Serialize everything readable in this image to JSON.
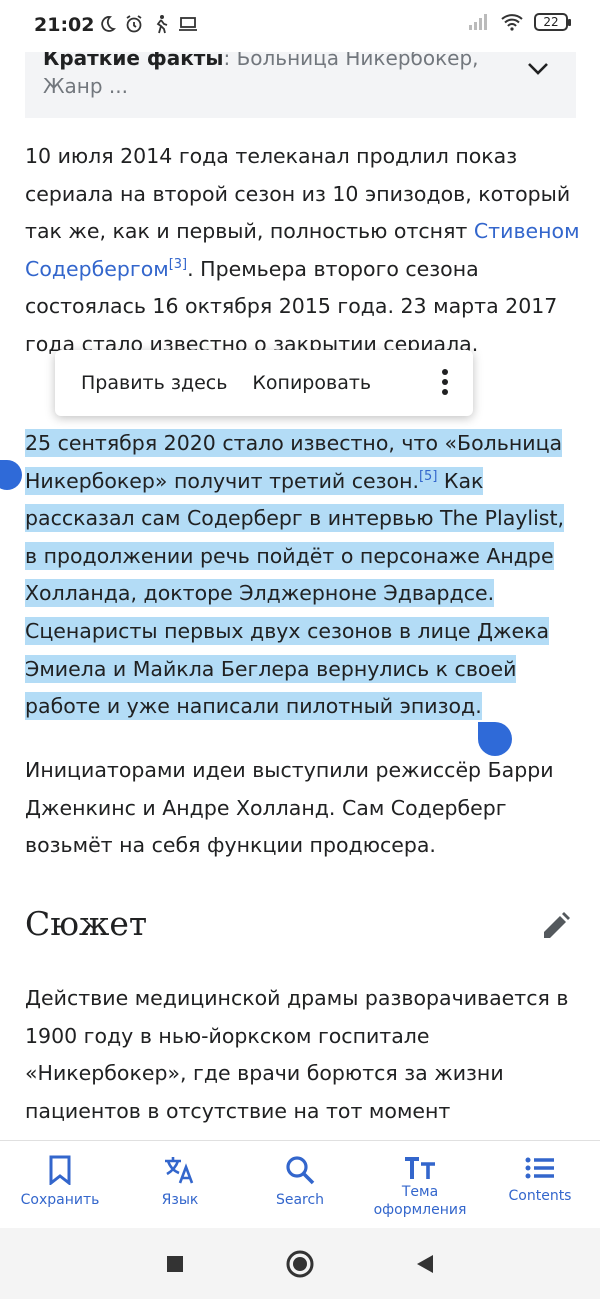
{
  "status_bar": {
    "time": "21:02",
    "battery": "22",
    "icons": [
      "moon-icon",
      "alarm-icon",
      "walking-icon",
      "laptop-icon",
      "signal-icon",
      "wifi-icon",
      "battery-icon"
    ]
  },
  "quick_facts": {
    "label": "Краткие факты",
    "summary": ": Больница Никербокер,",
    "summary2": "Жанр ..."
  },
  "paragraph1": {
    "text_a": "10 июля 2014 года телеканал продлил показ сериала на второй сезон из 10 эпизодов, который так же, как и первый, полностью отснят ",
    "link": "Стивеном Содербергом",
    "ref": "[3]",
    "text_b": ". Премьера второго сезона состоялась 16 октября 2015 года. 23 марта 2017 года стало известно о закрытии сериала."
  },
  "context_menu": {
    "edit_here": "Править здесь",
    "copy": "Копировать"
  },
  "paragraph2": {
    "text_a": "25 сентября 2020 стало известно, что «Больница Никербокер» получит третий сезон.",
    "ref": "[5]",
    "text_b": " Как рассказал сам Содерберг в интервью The Playlist, в продолжении речь пойдёт о персонаже Андре Холланда, докторе Элджерноне Эдвардсе. Сценаристы первых двух сезонов в лице Джека Эмиела и Майкла Беглера вернулись к своей работе и уже написали пилотный эпизод."
  },
  "paragraph3": {
    "text": "Инициаторами идеи выступили режиссёр Барри Дженкинс и Андре Холланд. Сам Содерберг возьмёт на себя функции продюсера."
  },
  "section": {
    "title": "Сюжет"
  },
  "paragraph4": {
    "text": "Действие медицинской драмы разворачивается в 1900 году в нью-йоркском госпитале «Никербокер», где врачи борются за жизни пациентов в отсутствие на тот момент"
  },
  "bottom_nav": {
    "save": "Сохранить",
    "language": "Язык",
    "search": "Search",
    "theme": "Тема оформления",
    "contents": "Contents"
  },
  "colors": {
    "accent": "#3366cc",
    "selection": "#b3dcf6",
    "handle": "#2f6ad8"
  }
}
